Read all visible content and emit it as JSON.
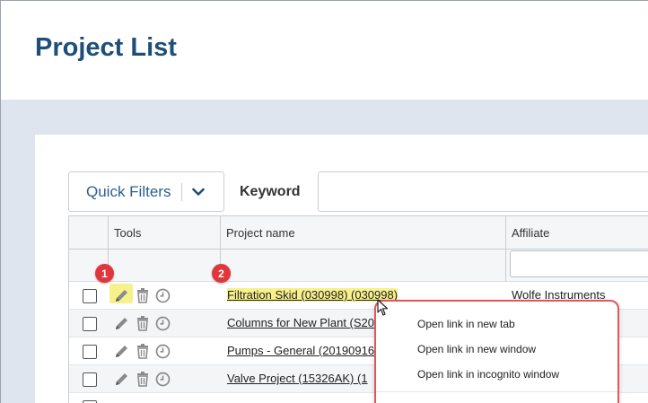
{
  "header": {
    "title": "Project List"
  },
  "toolbar": {
    "quick_filters_label": "Quick Filters",
    "keyword_label": "Keyword",
    "keyword_value": ""
  },
  "grid": {
    "columns": [
      "",
      "Tools",
      "Project name",
      "Affiliate"
    ],
    "rows": [
      {
        "project": "Filtration Skid (030998) (030998)",
        "affiliate": "Wolfe Instruments",
        "highlighted": true
      },
      {
        "project": "Columns for New Plant (S20",
        "affiliate": ""
      },
      {
        "project": "Pumps - General (20190916",
        "affiliate": ""
      },
      {
        "project": "Valve Project (15326AK) (1",
        "affiliate": ""
      }
    ]
  },
  "callouts": [
    "1",
    "2"
  ],
  "context_menu": {
    "items": [
      "Open link in new tab",
      "Open link in new window",
      "Open link in incognito window"
    ]
  },
  "colors": {
    "title": "#1f4f78",
    "highlight": "#f7f18c",
    "callout": "#e1363b",
    "menu_border": "#e2565a"
  },
  "icons": [
    "pencil-icon",
    "trash-icon",
    "clock-icon",
    "chevron-down-icon",
    "mouse-cursor-icon"
  ]
}
